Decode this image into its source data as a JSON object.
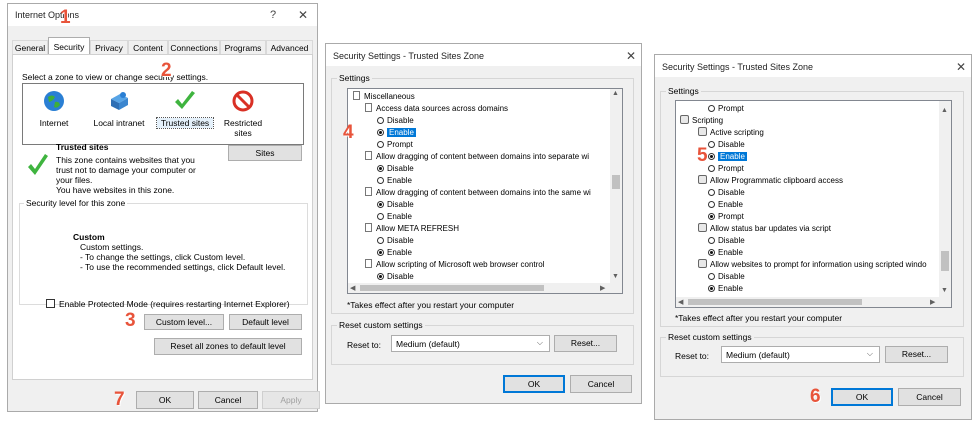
{
  "annotations": {
    "a1": "1",
    "a2": "2",
    "a3": "3",
    "a4": "4",
    "a5": "5",
    "a6": "6",
    "a7": "7"
  },
  "internet_options": {
    "title": "Internet Options",
    "help_glyph": "?",
    "close_glyph": "✕",
    "tabs": [
      "General",
      "Security",
      "Privacy",
      "Content",
      "Connections",
      "Programs",
      "Advanced"
    ],
    "zone_prompt": "Select a zone to view or change security settings.",
    "zones": [
      "Internet",
      "Local intranet",
      "Trusted sites",
      "Restricted sites"
    ],
    "zone_heading": "Trusted sites",
    "zone_desc": [
      "This zone contains websites that you",
      "trust not to damage your computer or",
      "your files.",
      "You have websites in this zone."
    ],
    "sites_button": "Sites",
    "security_level_title": "Security level for this zone",
    "custom_heading": "Custom",
    "custom_lines": [
      "Custom settings.",
      "- To change the settings, click Custom level.",
      "- To use the recommended settings, click Default level."
    ],
    "protected_mode_label": "Enable Protected Mode (requires restarting Internet Explorer)",
    "custom_level_button": "Custom level...",
    "default_level_button": "Default level",
    "reset_all_button": "Reset all zones to default level",
    "ok": "OK",
    "cancel": "Cancel",
    "apply": "Apply"
  },
  "sec1": {
    "title": "Security Settings - Trusted Sites Zone",
    "close_glyph": "✕",
    "settings_label": "Settings",
    "rows": [
      {
        "kind": "category",
        "text": "Miscellaneous"
      },
      {
        "kind": "item",
        "text": "Access data sources across domains"
      },
      {
        "kind": "radio",
        "text": "Disable",
        "on": false,
        "selected": false
      },
      {
        "kind": "radio",
        "text": "Enable",
        "on": true,
        "selected": true
      },
      {
        "kind": "radio",
        "text": "Prompt",
        "on": false,
        "selected": false
      },
      {
        "kind": "item",
        "text": "Allow dragging of content between domains into separate wi"
      },
      {
        "kind": "radio",
        "text": "Disable",
        "on": true,
        "selected": false
      },
      {
        "kind": "radio",
        "text": "Enable",
        "on": false,
        "selected": false
      },
      {
        "kind": "item",
        "text": "Allow dragging of content between domains into the same wi"
      },
      {
        "kind": "radio",
        "text": "Disable",
        "on": true,
        "selected": false
      },
      {
        "kind": "radio",
        "text": "Enable",
        "on": false,
        "selected": false
      },
      {
        "kind": "item",
        "text": "Allow META REFRESH"
      },
      {
        "kind": "radio",
        "text": "Disable",
        "on": false,
        "selected": false
      },
      {
        "kind": "radio",
        "text": "Enable",
        "on": true,
        "selected": false
      },
      {
        "kind": "item",
        "text": "Allow scripting of Microsoft web browser control"
      },
      {
        "kind": "radio",
        "text": "Disable",
        "on": true,
        "selected": false
      }
    ],
    "note": "*Takes effect after you restart your computer",
    "reset_group": "Reset custom settings",
    "reset_to_label": "Reset to:",
    "reset_value": "Medium (default)",
    "reset_button": "Reset...",
    "ok": "OK",
    "cancel": "Cancel"
  },
  "sec2": {
    "title": "Security Settings - Trusted Sites Zone",
    "close_glyph": "✕",
    "settings_label": "Settings",
    "rows": [
      {
        "kind": "radio",
        "indent": 1,
        "text": "Prompt",
        "on": false,
        "selected": false
      },
      {
        "kind": "category",
        "indent": 0,
        "text": "Scripting"
      },
      {
        "kind": "item",
        "indent": 1,
        "text": "Active scripting"
      },
      {
        "kind": "radio",
        "indent": 1,
        "text": "Disable",
        "on": false,
        "selected": false
      },
      {
        "kind": "radio",
        "indent": 1,
        "text": "Enable",
        "on": true,
        "selected": true
      },
      {
        "kind": "radio",
        "indent": 1,
        "text": "Prompt",
        "on": false,
        "selected": false
      },
      {
        "kind": "item",
        "indent": 1,
        "text": "Allow Programmatic clipboard access"
      },
      {
        "kind": "radio",
        "indent": 1,
        "text": "Disable",
        "on": false,
        "selected": false
      },
      {
        "kind": "radio",
        "indent": 1,
        "text": "Enable",
        "on": false,
        "selected": false
      },
      {
        "kind": "radio",
        "indent": 1,
        "text": "Prompt",
        "on": true,
        "selected": false
      },
      {
        "kind": "item",
        "indent": 1,
        "text": "Allow status bar updates via script"
      },
      {
        "kind": "radio",
        "indent": 1,
        "text": "Disable",
        "on": false,
        "selected": false
      },
      {
        "kind": "radio",
        "indent": 1,
        "text": "Enable",
        "on": true,
        "selected": false
      },
      {
        "kind": "item",
        "indent": 1,
        "text": "Allow websites to prompt for information using scripted windo"
      },
      {
        "kind": "radio",
        "indent": 1,
        "text": "Disable",
        "on": false,
        "selected": false
      },
      {
        "kind": "radio",
        "indent": 1,
        "text": "Enable",
        "on": true,
        "selected": false
      }
    ],
    "note": "*Takes effect after you restart your computer",
    "reset_group": "Reset custom settings",
    "reset_to_label": "Reset to:",
    "reset_value": "Medium (default)",
    "reset_button": "Reset...",
    "ok": "OK",
    "cancel": "Cancel"
  },
  "colors": {
    "annotation": "#e8543b",
    "selection": "#0078d7",
    "default_button_border": "#0078d7"
  },
  "icons": [
    "globe-icon",
    "intranet-icon",
    "checkmark-icon",
    "restricted-icon",
    "dropdown-chevron-icon"
  ]
}
